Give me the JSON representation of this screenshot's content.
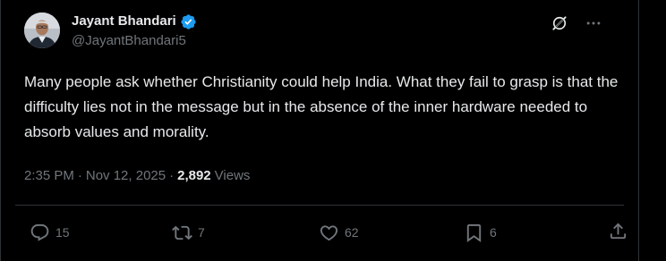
{
  "author": {
    "display_name": "Jayant Bhandari",
    "handle": "@JayantBhandari5",
    "avatar_icon": "person-avatar",
    "verified_icon": "verified-badge-icon",
    "verified_color": "#1d9bf0"
  },
  "header_icons": {
    "grok": "grok-icon",
    "more": "more-icon"
  },
  "tweet": {
    "text": "Many people ask whether Christianity could help India. What they fail to grasp is that the difficulty lies not in the message but in the absence of the inner hardware needed to absorb values and morality."
  },
  "meta": {
    "time": "2:35 PM",
    "separator": "·",
    "date": "Nov 12, 2025",
    "separator2": "·",
    "views_count": "2,892",
    "views_label": "Views"
  },
  "actions": {
    "reply": {
      "icon": "reply-icon",
      "count": "15"
    },
    "repost": {
      "icon": "repost-icon",
      "count": "7"
    },
    "like": {
      "icon": "heart-icon",
      "count": "62"
    },
    "bookmark": {
      "icon": "bookmark-icon",
      "count": "6"
    },
    "share": {
      "icon": "share-icon"
    }
  },
  "colors": {
    "background": "#000000",
    "text_primary": "#e7e9ea",
    "text_secondary": "#71767b",
    "border": "#2f3336"
  }
}
